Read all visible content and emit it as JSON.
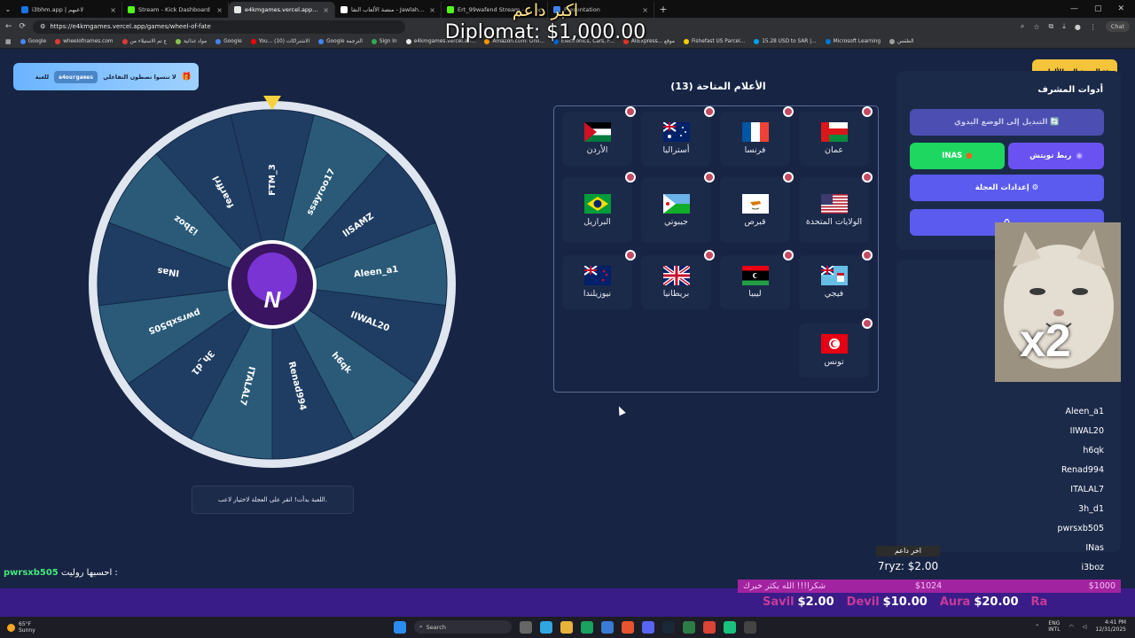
{
  "browser": {
    "tabs": [
      {
        "title": "i3bhm.app | لاعبهم",
        "color": "#1a73e8",
        "active": false
      },
      {
        "title": "Stream - Kick Dashboard",
        "color": "#53fc18",
        "active": false
      },
      {
        "title": "e4kmgames.vercel.app/games/wh",
        "color": "#e8e8e8",
        "active": true
      },
      {
        "title": "منصة الألعاب التفا - Jawlah | جولة",
        "color": "#ffffff",
        "active": false
      },
      {
        "title": "Ert_99wafend Stream - Watch Live",
        "color": "#53fc18",
        "active": false
      },
      {
        "title": "Presentation",
        "color": "#4285f4",
        "active": false
      }
    ],
    "url": "https://e4kmgames.vercel.app/games/wheel-of-fate",
    "chat_label": "Chat",
    "bookmarks": [
      "Google",
      "wheelofnames.com",
      "ع تم الاستيلاء من",
      "مواد غذائية",
      "Google",
      "You... (10) الاشتراكات",
      "Google الترجمة",
      "Sign In",
      "e4kmgames.vercel.ap...",
      "Amazon.com: Onli...",
      "Electronics, Cars, F...",
      "AliExpress... موقع",
      "Fishefast US Parcel...",
      "15.28 USD to SAR |...",
      "Microsoft Learning",
      "الطقس"
    ]
  },
  "donation_alert": {
    "arabic": "اكبر داعم",
    "line": "Diplomat: $1,000.00"
  },
  "promo": {
    "text": "لا تنسوا تصطون التفاعلي",
    "code": "e4ourgames",
    "suffix": "للعبة"
  },
  "wheel": {
    "names": [
      "FTM_3",
      "ssayroo17",
      "lISAMZ",
      "Aleen_a1",
      "IIWAL20",
      "h6qk",
      "Renad994",
      "ITALAL7",
      "3h_d1",
      "pwrsxb505",
      "INas",
      "i3boz",
      "fearffrl"
    ],
    "colors": [
      "#1f3d63",
      "#2a5a78"
    ],
    "center_letter": "N"
  },
  "status_message": "اللعبة بدأت! انقر على العجلة لاختيار لاعب.",
  "flags": {
    "title": "الأعلام المتاحة (13)",
    "items": [
      {
        "name": "عمان",
        "flag": "oman"
      },
      {
        "name": "فرنسا",
        "flag": "france"
      },
      {
        "name": "أستراليا",
        "flag": "australia"
      },
      {
        "name": "الأردن",
        "flag": "jordan"
      },
      {
        "name": "الولايات المتحدة",
        "flag": "usa"
      },
      {
        "name": "قبرص",
        "flag": "cyprus"
      },
      {
        "name": "جيبوتي",
        "flag": "djibouti"
      },
      {
        "name": "البرازيل",
        "flag": "brazil"
      },
      {
        "name": "فيجي",
        "flag": "fiji"
      },
      {
        "name": "ليبيا",
        "flag": "libya"
      },
      {
        "name": "بريطانيا",
        "flag": "uk"
      },
      {
        "name": "نيوزيلندا",
        "flag": "newzealand"
      },
      {
        "name": "تونس",
        "flag": "tunisia"
      }
    ]
  },
  "admin": {
    "back_label": "العودة إلى الألعاب ↩",
    "title": "أدوات المشرف",
    "manual_mode": "التبديل إلى الوضع اليدوي 🔄",
    "twitch_link": "ربط تويتش",
    "inas_label": "INAS",
    "wheel_settings": "إعدادات العجلة ⚙",
    "fourth_button": "♻"
  },
  "players": [
    "Aleen_a1",
    "IIWAL20",
    "h6qk",
    "Renad994",
    "ITALAL7",
    "3h_d1",
    "pwrsxb505",
    "INas",
    "i3boz",
    "fearffrl"
  ],
  "overlay": {
    "x2": "x2",
    "last_donor_title": "اخر داعم",
    "last_donor_value": "7ryz: $2.00",
    "ticker_name": "pwrsxb505",
    "ticker_text": "احسبها روليت :",
    "goal_text": "شكرا!!! الله يكثر خيرك",
    "goal_current": "$1024",
    "goal_target": "$1000",
    "tips": [
      {
        "label": "Savil",
        "value": "$2.00"
      },
      {
        "label": "Devil",
        "value": "$10.00"
      },
      {
        "label": "Aura",
        "value": "$20.00"
      },
      {
        "label": "Ra",
        "value": ""
      }
    ]
  },
  "taskbar": {
    "temp": "65°F",
    "weather": "Sunny",
    "search": "Search",
    "lang1": "ENG",
    "lang2": "INTL",
    "time": "4:41 PM",
    "date": "12/31/2025"
  }
}
